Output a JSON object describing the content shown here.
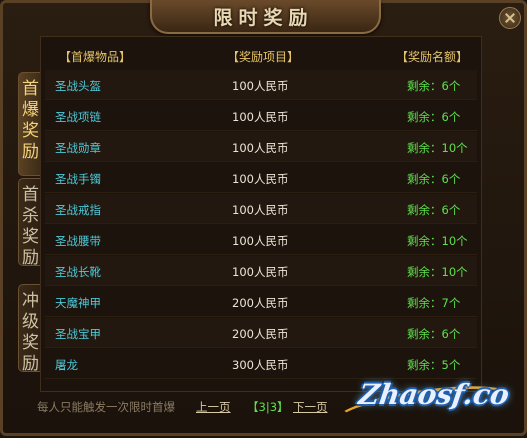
{
  "window": {
    "title": "限时奖励"
  },
  "tabs": [
    {
      "label": "首爆奖励"
    },
    {
      "label": "首杀奖励"
    },
    {
      "label": "冲级奖励"
    }
  ],
  "table": {
    "headers": [
      "【首爆物品】",
      "【奖励项目】",
      "【奖励名额】"
    ],
    "rows": [
      {
        "name": "圣战头盔",
        "reward": "100人民币",
        "count": "剩余：6个"
      },
      {
        "name": "圣战项链",
        "reward": "100人民币",
        "count": "剩余：6个"
      },
      {
        "name": "圣战勋章",
        "reward": "100人民币",
        "count": "剩余：10个"
      },
      {
        "name": "圣战手镯",
        "reward": "100人民币",
        "count": "剩余：6个"
      },
      {
        "name": "圣战戒指",
        "reward": "100人民币",
        "count": "剩余：6个"
      },
      {
        "name": "圣战腰带",
        "reward": "100人民币",
        "count": "剩余：10个"
      },
      {
        "name": "圣战长靴",
        "reward": "100人民币",
        "count": "剩余：10个"
      },
      {
        "name": "天魔神甲",
        "reward": "200人民币",
        "count": "剩余：7个"
      },
      {
        "name": "圣战宝甲",
        "reward": "200人民币",
        "count": "剩余：6个"
      },
      {
        "name": "屠龙",
        "reward": "300人民币",
        "count": "剩余：5个"
      }
    ]
  },
  "footer": {
    "note": "每人只能触发一次限时首爆",
    "prev": "上一页",
    "page": "【3|3】",
    "next": "下一页"
  },
  "watermark": {
    "text": "Zhaosf.co"
  },
  "colors": {
    "item_name": "#4ec9d8",
    "reward": "#ece5d6",
    "remaining": "#5fe04e",
    "header": "#e6c46a"
  }
}
